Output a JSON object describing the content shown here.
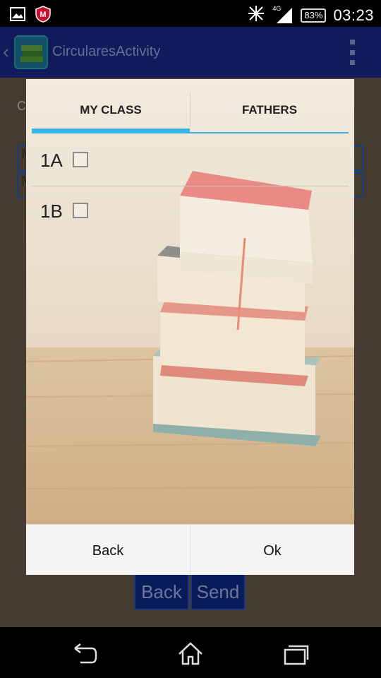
{
  "status_bar": {
    "network_label": "4G",
    "battery": "83%",
    "time": "03:23",
    "icons": [
      "image-notification-icon",
      "mcafee-icon",
      "airplane-mode-icon",
      "signal-icon",
      "battery-icon"
    ]
  },
  "action_bar": {
    "title": "CircularesActivity"
  },
  "background_screen": {
    "label_initial": "C",
    "field1_initial": "M",
    "field2_initial": "M",
    "back_button": "Back",
    "send_button": "Send"
  },
  "dialog": {
    "tabs": [
      {
        "label": "MY CLASS",
        "selected": true
      },
      {
        "label": "FATHERS",
        "selected": false
      }
    ],
    "items": [
      {
        "label": "1A",
        "checked": false
      },
      {
        "label": "1B",
        "checked": false
      }
    ],
    "buttons": {
      "negative": "Back",
      "positive": "Ok"
    }
  },
  "colors": {
    "action_bar": "#1c2a8e",
    "tab_indicator": "#33b5e5",
    "field_border": "#1e63c9"
  }
}
